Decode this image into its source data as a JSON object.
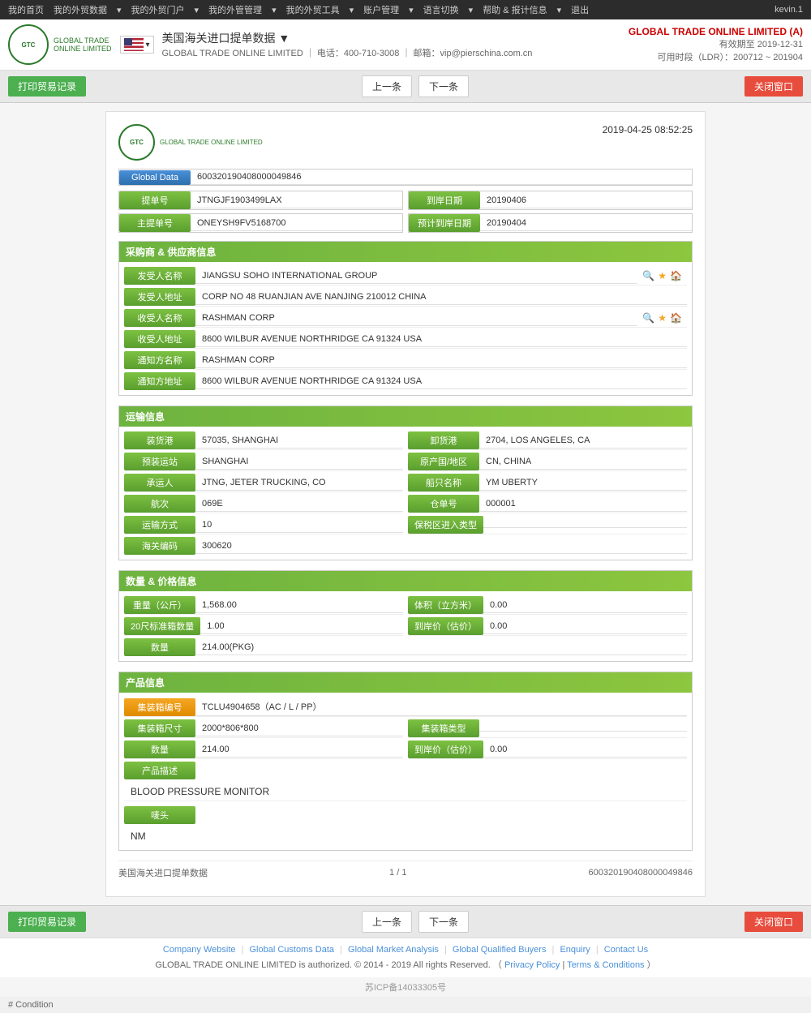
{
  "topnav": {
    "items": [
      "我的首页",
      "我的外贸数据",
      "我的外贸门户",
      "我的外管管理",
      "我的外贸工具",
      "账户管理",
      "语言切换",
      "帮助 & 报计信息",
      "退出"
    ],
    "user": "kevin.1"
  },
  "header": {
    "title": "美国海关进口提单数据 ▼",
    "subtitle_prefix": "GLOBAL TRADE ONLINE LIMITED",
    "subtitle_phone": "电话：400-710-3008",
    "subtitle_email": "邮箱：vip@pierschina.com.cn",
    "company_name": "GLOBAL TRADE ONLINE LIMITED (A)",
    "validity_label": "有效期至",
    "validity_date": "2019-12-31",
    "ldr_label": "可用时段（LDR）：200712 ~ 201904"
  },
  "toolbar": {
    "print_label": "打印贸易记录",
    "prev_label": "上一条",
    "next_label": "下一条",
    "close_label": "关闭窗口"
  },
  "doc": {
    "timestamp": "2019-04-25  08:52:25",
    "logo_sub": "GLOBAL TRADE ONLINE LIMITED",
    "global_data_label": "Global Data",
    "global_data_value": "600320190408000049846",
    "bill_no_label": "提单号",
    "bill_no_value": "JTNGJF1903499LAX",
    "arrival_date_label": "到岸日期",
    "arrival_date_value": "20190406",
    "master_bill_label": "主提单号",
    "master_bill_value": "ONEYSH9FV5168700",
    "eta_label": "预计到岸日期",
    "eta_value": "20190404",
    "supplier_section": "采购商 & 供应商信息",
    "shipper_name_label": "发受人名称",
    "shipper_name_value": "JIANGSU SOHO INTERNATIONAL GROUP",
    "shipper_addr_label": "发受人地址",
    "shipper_addr_value": "CORP NO 48 RUANJIAN AVE NANJING 210012 CHINA",
    "consignee_name_label": "收受人名称",
    "consignee_name_value": "RASHMAN CORP",
    "consignee_addr_label": "收受人地址",
    "consignee_addr_value": "8600 WILBUR AVENUE NORTHRIDGE CA 91324 USA",
    "notify_name_label": "通知方名称",
    "notify_name_value": "RASHMAN CORP",
    "notify_addr_label": "通知方地址",
    "notify_addr_value": "8600 WILBUR AVENUE NORTHRIDGE CA 91324 USA",
    "transport_section": "运输信息",
    "loading_port_label": "装货港",
    "loading_port_value": "57035, SHANGHAI",
    "unloading_port_label": "卸货港",
    "unloading_port_value": "2704, LOS ANGELES, CA",
    "loading_dest_label": "预装运站",
    "loading_dest_value": "SHANGHAI",
    "origin_label": "原产国/地区",
    "origin_value": "CN, CHINA",
    "carrier_label": "承运人",
    "carrier_value": "JTNG, JETER TRUCKING, CO",
    "vessel_label": "船只名称",
    "vessel_value": "YM UBERTY",
    "voyage_label": "航次",
    "voyage_value": "069E",
    "warehouse_label": "仓单号",
    "warehouse_value": "000001",
    "transport_mode_label": "运输方式",
    "transport_mode_value": "10",
    "bonded_label": "保税区进入类型",
    "bonded_value": "",
    "customs_code_label": "海关编码",
    "customs_code_value": "300620",
    "quantity_section": "数量 & 价格信息",
    "weight_label": "重量（公斤）",
    "weight_value": "1,568.00",
    "volume_label": "体积（立方米）",
    "volume_value": "0.00",
    "teu_label": "20尺标准箱数量",
    "teu_value": "1.00",
    "arrival_price_label": "到岸价（估价）",
    "arrival_price_value": "0.00",
    "qty_label": "数量",
    "qty_value": "214.00(PKG)",
    "product_section": "产品信息",
    "container_no_label": "集装箱编号",
    "container_no_value": "TCLU4904658（AC / L / PP）",
    "container_size_label": "集装箱尺寸",
    "container_size_value": "2000*806*800",
    "container_type_label": "集装箱类型",
    "container_type_value": "",
    "qty2_label": "数量",
    "qty2_value": "214.00",
    "arrival_price2_label": "到岸价（估价）",
    "arrival_price2_value": "0.00",
    "desc_label": "产品描述",
    "desc_value": "BLOOD PRESSURE MONITOR",
    "mark_label": "唛头",
    "mark_value": "NM"
  },
  "doc_footer": {
    "left": "美国海关进口提单数据",
    "center": "1 / 1",
    "right": "600320190408000049846"
  },
  "site_footer": {
    "links": [
      "Company Website",
      "Global Customs Data",
      "Global Market Analysis",
      "Global Qualified Buyers",
      "Enquiry",
      "Contact Us"
    ],
    "copyright": "GLOBAL TRADE ONLINE LIMITED is authorized. © 2014 - 2019 All rights Reserved. （",
    "privacy": "Privacy Policy",
    "sep": "|",
    "terms": "Terms & Conditions",
    "end": "）"
  },
  "beian": {
    "text": "苏ICP备14033305号"
  },
  "condition_footer": {
    "label": "# Condition"
  }
}
